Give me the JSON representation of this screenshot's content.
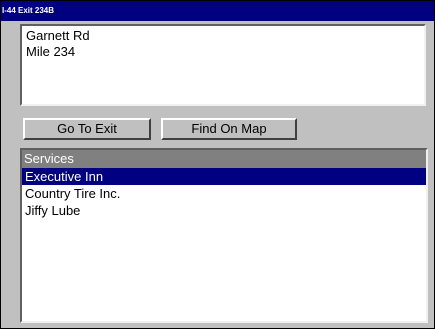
{
  "window": {
    "title": "I-44 Exit 234B"
  },
  "address": {
    "lines": [
      "Garnett Rd",
      "Mile 234"
    ]
  },
  "buttons": {
    "go_to_exit": "Go To Exit",
    "find_on_map": "Find On Map"
  },
  "services": {
    "header": "Services",
    "items": [
      "Executive Inn",
      "Country Tire Inc.",
      "Jiffy Lube"
    ],
    "selected_index": 0
  },
  "colors": {
    "titlebar": "#000080",
    "selection": "#000080",
    "header": "#808080",
    "window": "#c0c0c0"
  }
}
